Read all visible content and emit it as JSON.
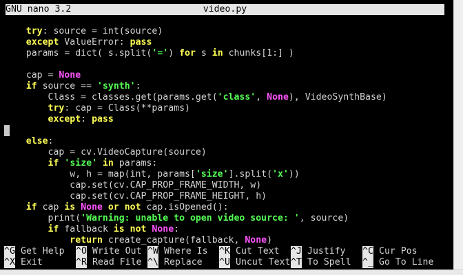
{
  "window": {
    "app_version": "GNU nano 3.2",
    "filename": "video.py"
  },
  "colors": {
    "background": "#000000",
    "text": "#d3d3d3",
    "keyword": "#ffff55",
    "builtin": "#ff55ff",
    "string": "#55ff55",
    "titlebar": "#e6e6e6"
  },
  "code_lines": [
    [
      [
        "",
        "    "
      ],
      [
        "kw",
        "try"
      ],
      [
        "",
        ": source = int(source)"
      ]
    ],
    [
      [
        "",
        "    "
      ],
      [
        "kw",
        "except"
      ],
      [
        "",
        " ValueError: "
      ],
      [
        "kw",
        "pass"
      ]
    ],
    [
      [
        "",
        "    params = dict( s.split("
      ],
      [
        "str",
        "'='"
      ],
      [
        "",
        ") "
      ],
      [
        "kw",
        "for"
      ],
      [
        "",
        " s "
      ],
      [
        "kw",
        "in"
      ],
      [
        "",
        " chunks[1:] )"
      ]
    ],
    [],
    [
      [
        "",
        "    cap = "
      ],
      [
        "builtin",
        "None"
      ]
    ],
    [
      [
        "",
        "    "
      ],
      [
        "kw",
        "if"
      ],
      [
        "",
        " source == "
      ],
      [
        "str",
        "'synth'"
      ],
      [
        "",
        ":"
      ]
    ],
    [
      [
        "",
        "        Class = classes.get(params.get("
      ],
      [
        "str",
        "'class'"
      ],
      [
        "",
        ", "
      ],
      [
        "builtin",
        "None"
      ],
      [
        "",
        "), VideoSynthBase)"
      ]
    ],
    [
      [
        "",
        "        "
      ],
      [
        "kw",
        "try"
      ],
      [
        "",
        ": cap = Class(**params)"
      ]
    ],
    [
      [
        "",
        "        "
      ],
      [
        "kw",
        "except"
      ],
      [
        "",
        ": "
      ],
      [
        "kw",
        "pass"
      ]
    ],
    [
      [
        "cursor",
        ""
      ]
    ],
    [
      [
        "",
        "    "
      ],
      [
        "kw",
        "else"
      ],
      [
        "",
        ":"
      ]
    ],
    [
      [
        "",
        "        cap = cv.VideoCapture(source)"
      ]
    ],
    [
      [
        "",
        "        "
      ],
      [
        "kw",
        "if"
      ],
      [
        "",
        " "
      ],
      [
        "str",
        "'size'"
      ],
      [
        "",
        " "
      ],
      [
        "kw",
        "in"
      ],
      [
        "",
        " params:"
      ]
    ],
    [
      [
        "",
        "            w, h = map(int, params["
      ],
      [
        "str",
        "'size'"
      ],
      [
        "",
        "].split("
      ],
      [
        "str",
        "'x'"
      ],
      [
        "",
        "))"
      ]
    ],
    [
      [
        "",
        "            cap.set(cv.CAP_PROP_FRAME_WIDTH, w)"
      ]
    ],
    [
      [
        "",
        "            cap.set(cv.CAP_PROP_FRAME_HEIGHT, h)"
      ]
    ],
    [
      [
        "",
        "    "
      ],
      [
        "kw",
        "if"
      ],
      [
        "",
        " cap "
      ],
      [
        "kw",
        "is"
      ],
      [
        "",
        " "
      ],
      [
        "builtin",
        "None"
      ],
      [
        "",
        " "
      ],
      [
        "kw",
        "or not"
      ],
      [
        "",
        " cap.isOpened():"
      ]
    ],
    [
      [
        "",
        "        print("
      ],
      [
        "str",
        "'Warning: unable to open video source: '"
      ],
      [
        "",
        ", source)"
      ]
    ],
    [
      [
        "",
        "        "
      ],
      [
        "kw",
        "if"
      ],
      [
        "",
        " fallback "
      ],
      [
        "kw",
        "is not"
      ],
      [
        "",
        " "
      ],
      [
        "builtin",
        "None"
      ],
      [
        "",
        ":"
      ]
    ],
    [
      [
        "",
        "            "
      ],
      [
        "kw",
        "return"
      ],
      [
        "",
        " create_capture(fallback, "
      ],
      [
        "builtin",
        "None"
      ],
      [
        "",
        ")"
      ]
    ]
  ],
  "shortcuts": [
    {
      "key": "^G",
      "label": "Get Help"
    },
    {
      "key": "^O",
      "label": "Write Out"
    },
    {
      "key": "^W",
      "label": "Where Is"
    },
    {
      "key": "^K",
      "label": "Cut Text"
    },
    {
      "key": "^J",
      "label": "Justify"
    },
    {
      "key": "^C",
      "label": "Cur Pos"
    },
    {
      "key": "^X",
      "label": "Exit"
    },
    {
      "key": "^R",
      "label": "Read File"
    },
    {
      "key": "^\\",
      "label": "Replace"
    },
    {
      "key": "^U",
      "label": "Uncut Text"
    },
    {
      "key": "^T",
      "label": "To Spell"
    },
    {
      "key": "^_",
      "label": "Go To Line"
    }
  ]
}
